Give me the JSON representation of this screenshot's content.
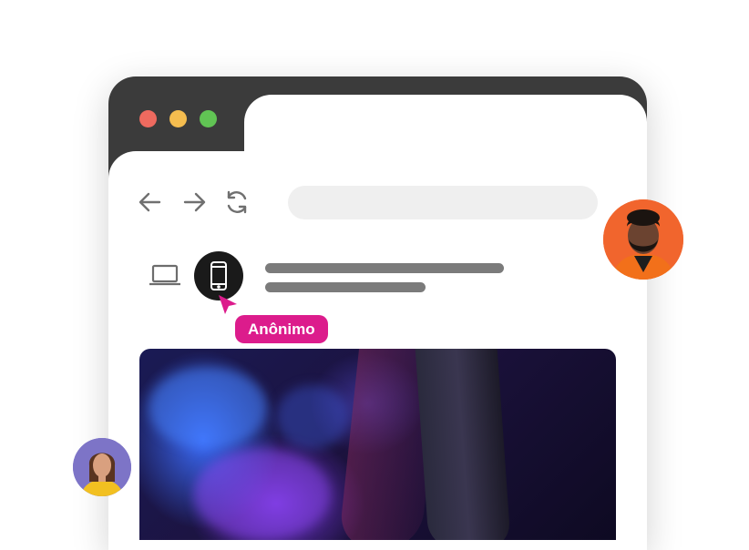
{
  "window": {
    "controls": [
      "red",
      "yellow",
      "green"
    ],
    "title_bar_color": "#3b3b3b"
  },
  "toolbar": {
    "back_icon": "arrow-left-icon",
    "forward_icon": "arrow-right-icon",
    "reload_icon": "reload-icon",
    "address_bar_value": ""
  },
  "device_switcher": {
    "desktop_icon": "laptop-icon",
    "mobile_icon": "smartphone-icon",
    "selected": "mobile"
  },
  "cursor_tag": {
    "label": "Anônimo",
    "color": "#dc1c8c"
  },
  "avatars": [
    {
      "name": "avatar-man",
      "background": "#f1652d"
    },
    {
      "name": "avatar-woman",
      "background": "#7d74c7"
    }
  ]
}
